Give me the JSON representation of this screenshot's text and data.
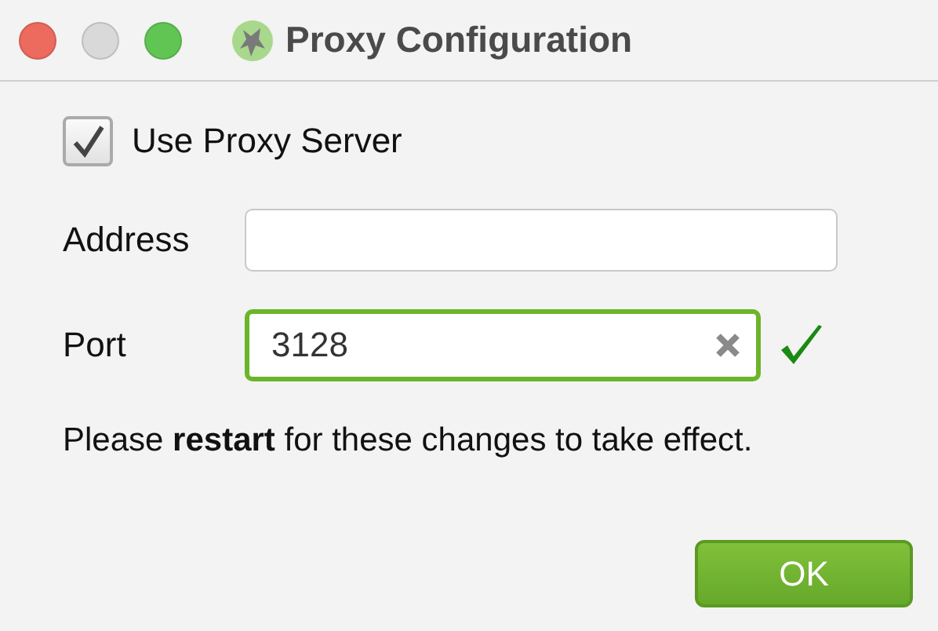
{
  "window": {
    "title": "Proxy Configuration"
  },
  "use_proxy": {
    "label": "Use Proxy Server",
    "checked": true
  },
  "address": {
    "label": "Address"
  },
  "port": {
    "label": "Port",
    "value": "3128",
    "valid": true
  },
  "message": "Please **restart** for these changes to take effect.",
  "buttons": [
    {
      "label": "OK",
      "kind": "primary"
    }
  ]
}
